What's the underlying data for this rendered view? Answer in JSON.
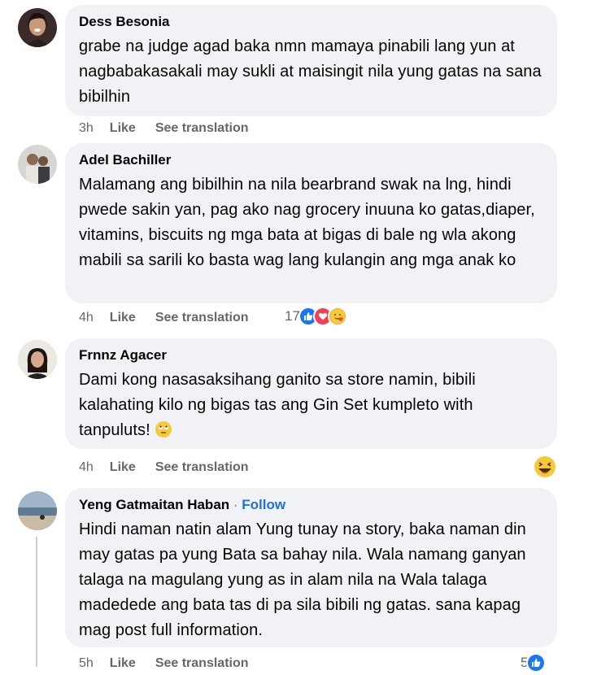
{
  "comments": [
    {
      "author": "Dess Besonia",
      "text": "grabe na judge agad baka nmn mamaya pinabili lang yun at nagbabakasakali may sukli at maisingit nila yung gatas na sana bibilhin",
      "time": "3h",
      "like_label": "Like",
      "translate_label": "See translation"
    },
    {
      "author": "Adel Bachiller",
      "text": "Malamang ang bibilhin na nila bearbrand swak na lng, hindi pwede sakin yan, pag ako nag grocery inuuna ko gatas,diaper, vitamins, biscuits ng mga bata at bigas di bale ng wla akong mabili sa sarili ko basta wag lang kulangin ang mga anak ko",
      "time": "4h",
      "like_label": "Like",
      "translate_label": "See translation",
      "reaction_count": "17"
    },
    {
      "author": "Frnnz Agacer",
      "text": "Dami kong nasasaksihang ganito sa store namin, bibili kalahating kilo ng bigas tas ang Gin Set kumpleto with tanpuluts!",
      "time": "4h",
      "like_label": "Like",
      "translate_label": "See translation"
    },
    {
      "author": "Yeng Gatmaitan Haban",
      "follow_sep": " · ",
      "follow_label": "Follow",
      "text": "Hindi naman natin alam Yung tunay na story, baka naman din may gatas pa yung Bata sa bahay nila. Wala namang ganyan talaga na magulang yung as in alam nila na Wala talaga madedede ang bata tas di pa sila bibili ng gatas. sana kapag mag post full information.",
      "time": "5h",
      "like_label": "Like",
      "translate_label": "See translation",
      "reaction_count": "5"
    }
  ],
  "colors": {
    "bubble": "#f0f2f5",
    "like_blue": "#1877f2",
    "love_red": "#f33e58",
    "haha_yellow": "#f7b125",
    "link_blue": "#216fdb"
  }
}
